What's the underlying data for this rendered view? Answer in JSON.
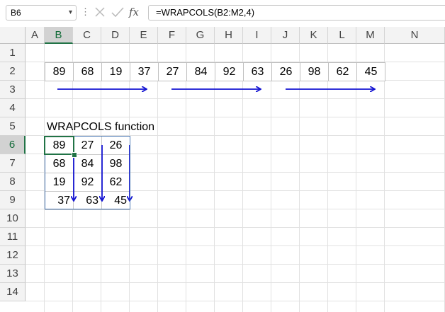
{
  "formula_bar": {
    "name_box": "B6",
    "name_box_dropdown": "▾",
    "separator": "⋮",
    "fx_label": "fx",
    "formula": "=WRAPCOLS(B2:M2,4)"
  },
  "columns": [
    "A",
    "B",
    "C",
    "D",
    "E",
    "F",
    "G",
    "H",
    "I",
    "J",
    "K",
    "L",
    "M",
    "N"
  ],
  "rows": [
    "1",
    "2",
    "3",
    "4",
    "5",
    "6",
    "7",
    "8",
    "9",
    "10",
    "11",
    "12",
    "13",
    "14"
  ],
  "selected_column": "B",
  "selected_row": "6",
  "source_values": [
    "89",
    "68",
    "19",
    "37",
    "27",
    "84",
    "92",
    "63",
    "26",
    "98",
    "62",
    "45"
  ],
  "function_label": "WRAPCOLS function",
  "result_grid": [
    [
      "89",
      "27",
      "26"
    ],
    [
      "68",
      "84",
      "98"
    ],
    [
      "19",
      "92",
      "62"
    ],
    [
      "37",
      "63",
      "45"
    ]
  ],
  "colors": {
    "arrow": "#1414d2",
    "selection": "#217346",
    "result_border": "#4a78b5"
  }
}
